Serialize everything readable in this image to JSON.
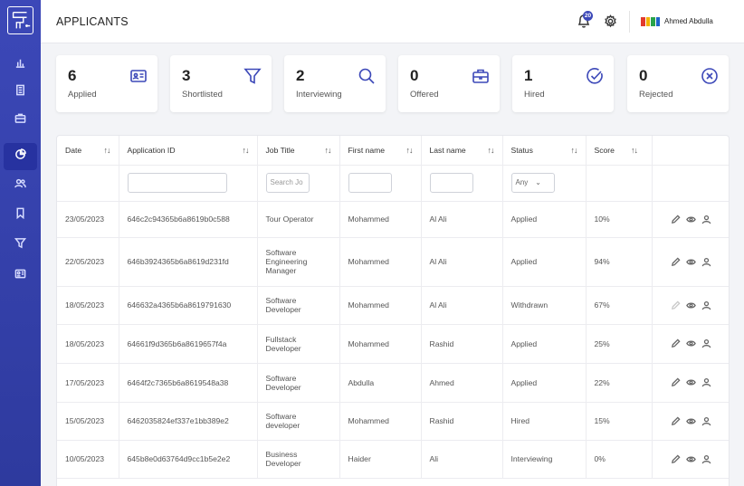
{
  "header": {
    "title": "APPLICANTS",
    "notification_count": "20",
    "user_name": "Ahmed Abdulla"
  },
  "colors": {
    "accent": "#3c48b8",
    "sidebar": "#3340ab"
  },
  "sidebar": {
    "items": [
      {
        "icon": "bar-chart-icon"
      },
      {
        "icon": "building-icon"
      },
      {
        "icon": "briefcase-icon"
      },
      {
        "icon": "pie-chart-icon",
        "active": true
      },
      {
        "icon": "users-icon"
      },
      {
        "icon": "bookmark-icon"
      },
      {
        "icon": "funnel-icon"
      },
      {
        "icon": "id-card-icon"
      }
    ]
  },
  "stats": [
    {
      "value": "6",
      "label": "Applied",
      "icon": "id-card-icon"
    },
    {
      "value": "3",
      "label": "Shortlisted",
      "icon": "funnel-icon"
    },
    {
      "value": "2",
      "label": "Interviewing",
      "icon": "search-icon"
    },
    {
      "value": "0",
      "label": "Offered",
      "icon": "briefcase-icon"
    },
    {
      "value": "1",
      "label": "Hired",
      "icon": "check-circle-icon"
    },
    {
      "value": "0",
      "label": "Rejected",
      "icon": "x-circle-icon"
    }
  ],
  "table": {
    "columns": [
      "Date",
      "Application ID",
      "Job Title",
      "First name",
      "Last name",
      "Status",
      "Score"
    ],
    "sort_glyph": "↑↓",
    "filters": {
      "job_title_placeholder": "Search Jo",
      "status_value": "Any"
    },
    "rows": [
      [
        "23/05/2023",
        "646c2c94365b6a8619b0c588",
        "Tour Operator",
        "Mohammed",
        "Al Ali",
        "Applied",
        "10%"
      ],
      [
        "22/05/2023",
        "646b3924365b6a8619d231fd",
        "Software Engineering Manager",
        "Mohammed",
        "Al Ali",
        "Applied",
        "94%"
      ],
      [
        "18/05/2023",
        "646632a4365b6a8619791630",
        "Software Developer",
        "Mohammed",
        "Al Ali",
        "Withdrawn",
        "67%"
      ],
      [
        "18/05/2023",
        "64661f9d365b6a8619657f4a",
        "Fullstack Developer",
        "Mohammed",
        "Rashid",
        "Applied",
        "25%"
      ],
      [
        "17/05/2023",
        "6464f2c7365b6a8619548a38",
        "Software Developer",
        "Abdulla",
        "Ahmed",
        "Applied",
        "22%"
      ],
      [
        "15/05/2023",
        "6462035824ef337e1bb389e2",
        "Software developer",
        "Mohammed",
        "Rashid",
        "Hired",
        "15%"
      ],
      [
        "10/05/2023",
        "645b8e0d63764d9cc1b5e2e2",
        "Business Developer",
        "Haider",
        "Ali",
        "Interviewing",
        "0%"
      ]
    ]
  }
}
